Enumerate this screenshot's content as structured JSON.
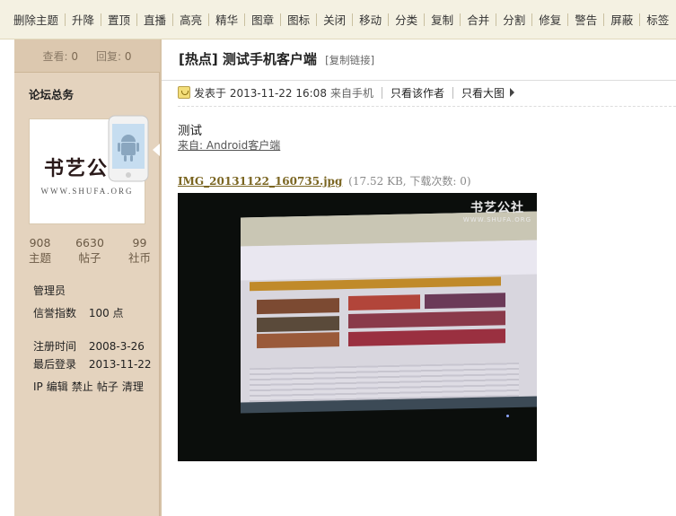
{
  "toolbar": {
    "items": [
      "删除主题",
      "升降",
      "置顶",
      "直播",
      "高亮",
      "精华",
      "图章",
      "图标",
      "关闭",
      "移动",
      "分类",
      "复制",
      "合并",
      "分割",
      "修复",
      "警告",
      "屏蔽",
      "标签"
    ]
  },
  "stats": {
    "views_label": "查看:",
    "views": "0",
    "replies_label": "回复:",
    "replies": "0"
  },
  "author": {
    "name": "论坛总务",
    "avatar_logo": "书艺公社",
    "avatar_url": "WWW.SHUFA.ORG",
    "counts": [
      {
        "value": "908",
        "label": "主题"
      },
      {
        "value": "6630",
        "label": "帖子"
      },
      {
        "value": "99",
        "label": "社币"
      }
    ],
    "group": "管理员",
    "credit_label": "信誉指数",
    "credit_value": "100 点",
    "reg_label": "注册时间",
    "reg_value": "2008-3-26",
    "last_label": "最后登录",
    "last_value": "2013-11-22",
    "actions": [
      "IP",
      "编辑",
      "禁止",
      "帖子",
      "清理"
    ]
  },
  "post": {
    "title": "[热点] 测试手机客户端",
    "copy_link": "[复制链接]",
    "posted": "发表于 2013-11-22 16:08",
    "from": "来自手机",
    "only_author": "只看该作者",
    "only_large": "只看大图",
    "message": "测试",
    "source": "来自: Android客户端",
    "attachment_name": "IMG_20131122_160735.jpg",
    "attachment_info": "(17.52 KB, 下载次数: 0)",
    "watermark_logo": "书艺公社",
    "watermark_url": "WWW.SHUFA.ORG"
  },
  "colors": {
    "toolbar_bg": "#f4f1e2",
    "sidebar_bg": "#e4d3be",
    "attachment_link": "#7a6521"
  }
}
